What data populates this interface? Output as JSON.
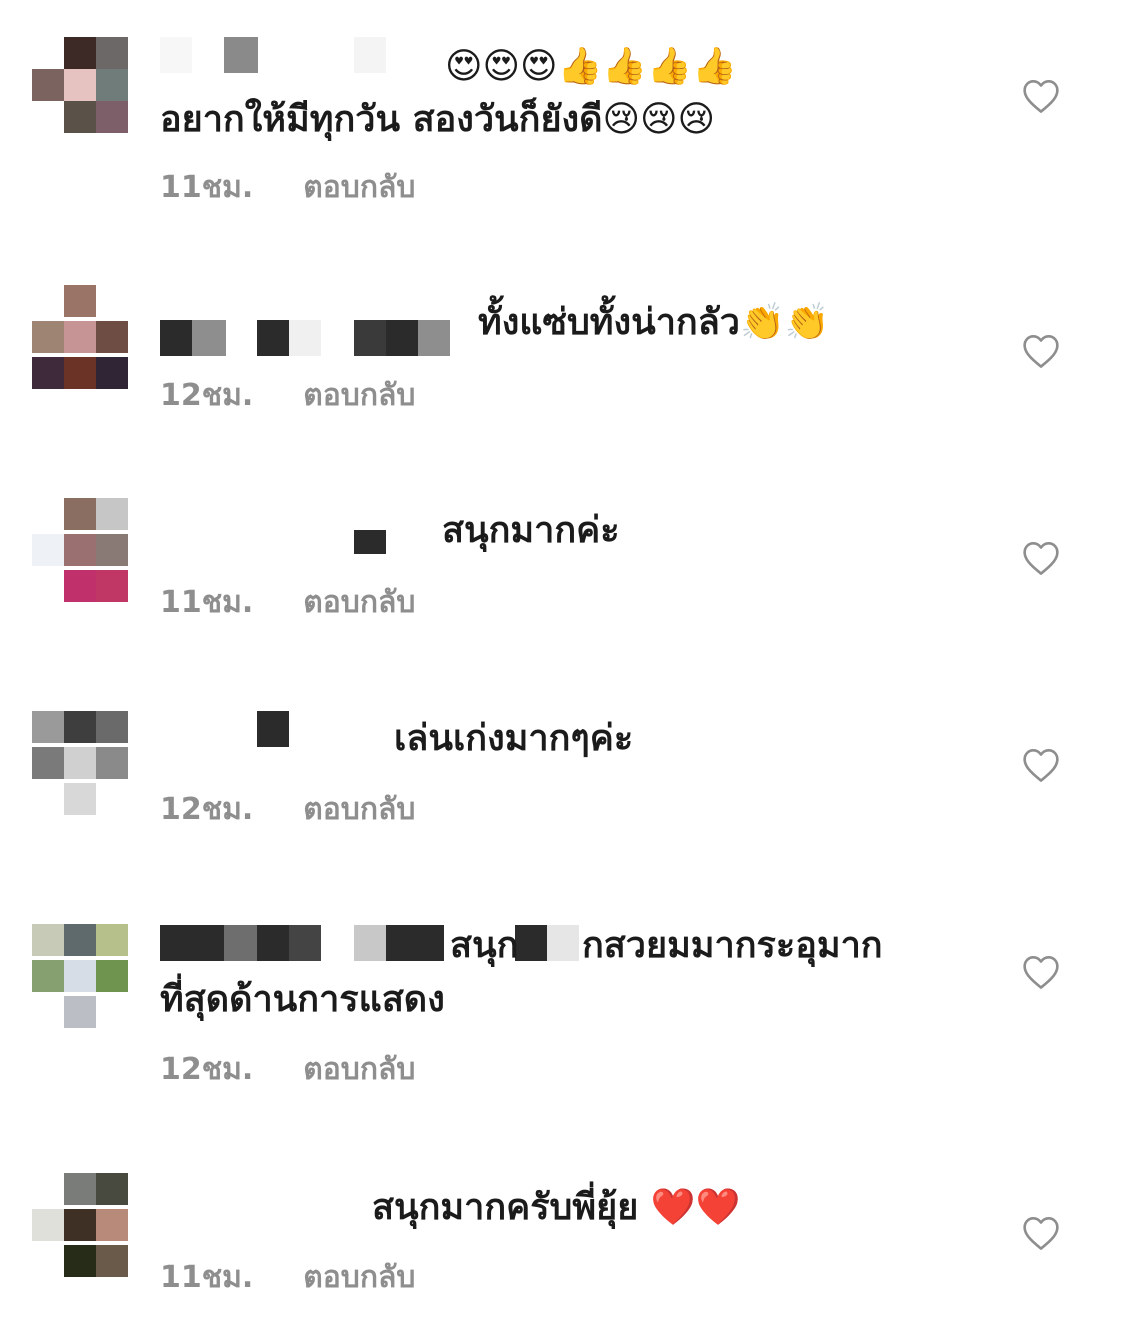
{
  "colors": {
    "text": "#1b1b1b",
    "meta": "#8e8e8e",
    "heart_outline": "#8e8e8e",
    "background": "#ffffff"
  },
  "icons": {
    "like": "heart-outline-icon"
  },
  "comments": [
    {
      "text_line1": "😍😍😍👍👍👍👍",
      "text_line2": "อยากให้มีทุกวัน สองวันก็ยังดี😢😢😢",
      "time": "11ชม.",
      "reply_label": "ตอบกลับ"
    },
    {
      "text_line1": "ทั้งแซ่บทั้งน่ากลัว👏👏",
      "time": "12ชม.",
      "reply_label": "ตอบกลับ"
    },
    {
      "text_line1": "สนุกมากค่ะ",
      "time": "11ชม.",
      "reply_label": "ตอบกลับ"
    },
    {
      "text_line1": "เล่นเก่งมากๆค่ะ",
      "time": "12ชม.",
      "reply_label": "ตอบกลับ"
    },
    {
      "text_line1": "สนุก",
      "text_line1b": "กสวยมมากระอุมาก",
      "text_line2": "ที่สุดด้านการแสดง",
      "time": "12ชม.",
      "reply_label": "ตอบกลับ"
    },
    {
      "text_line1": "สนุกมากครับพี่ยุ้ย ❤️❤️",
      "time": "11ชม.",
      "reply_label": "ตอบกลับ"
    }
  ]
}
